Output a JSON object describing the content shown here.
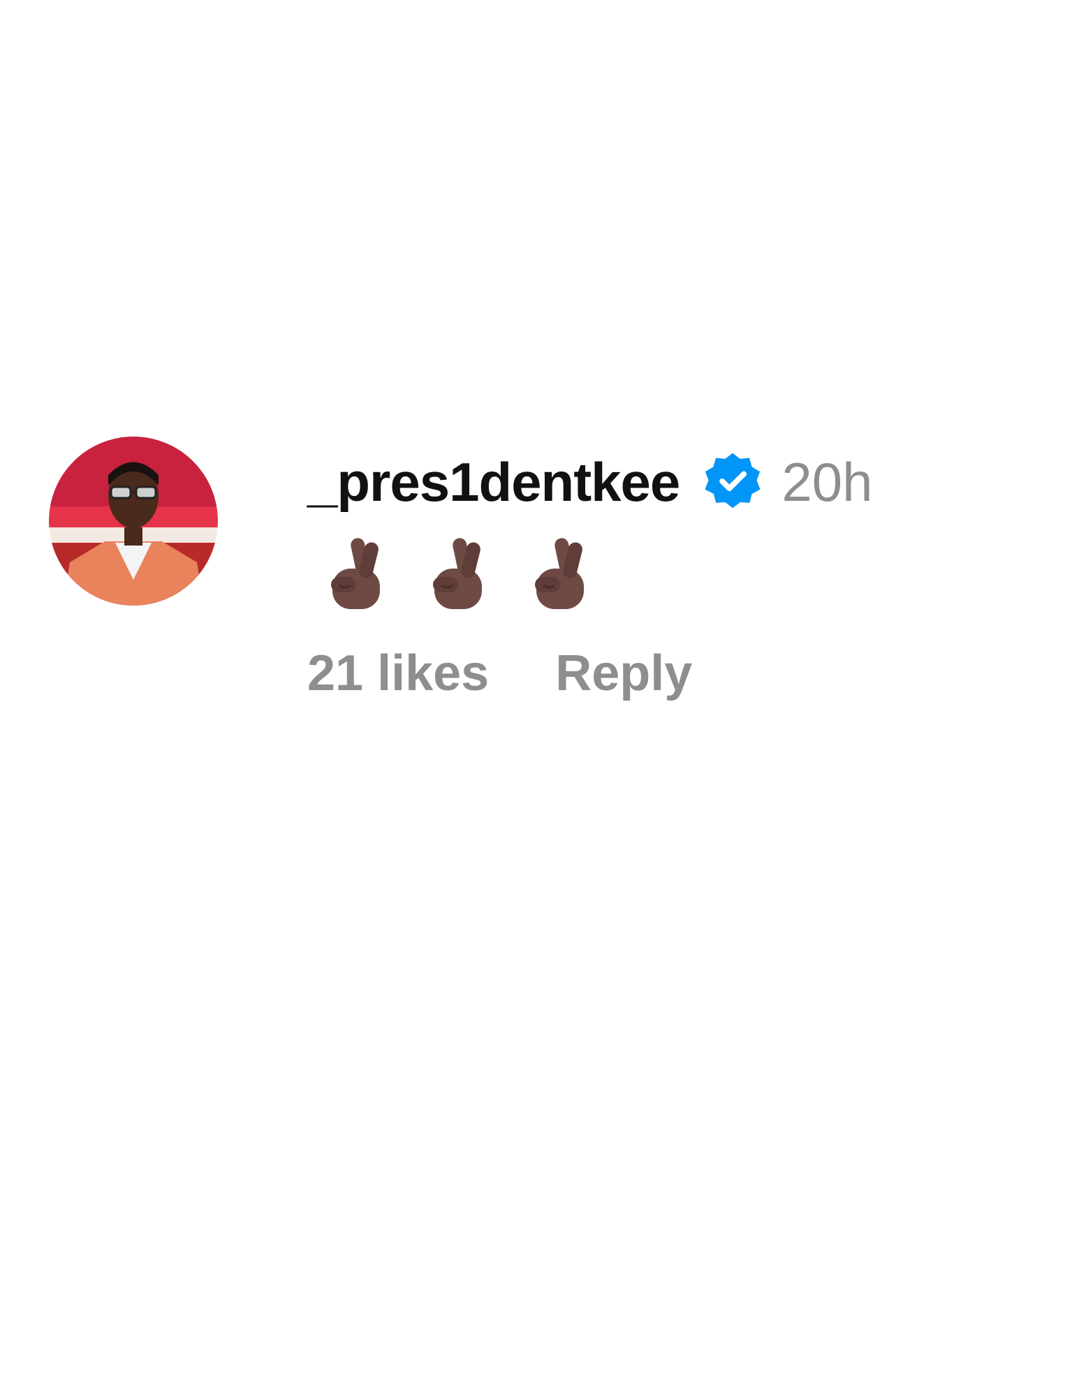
{
  "comment": {
    "username": "_pres1dentkee",
    "verified_icon": "verified-badge-icon",
    "timestamp": "20h",
    "emojis": [
      "crossed-fingers-dark-skin",
      "crossed-fingers-dark-skin",
      "crossed-fingers-dark-skin"
    ],
    "likes_label": "21 likes",
    "reply_label": "Reply"
  },
  "colors": {
    "verified_blue": "#0095f6",
    "muted_text": "#8e8e8e",
    "username_text": "#111111"
  }
}
